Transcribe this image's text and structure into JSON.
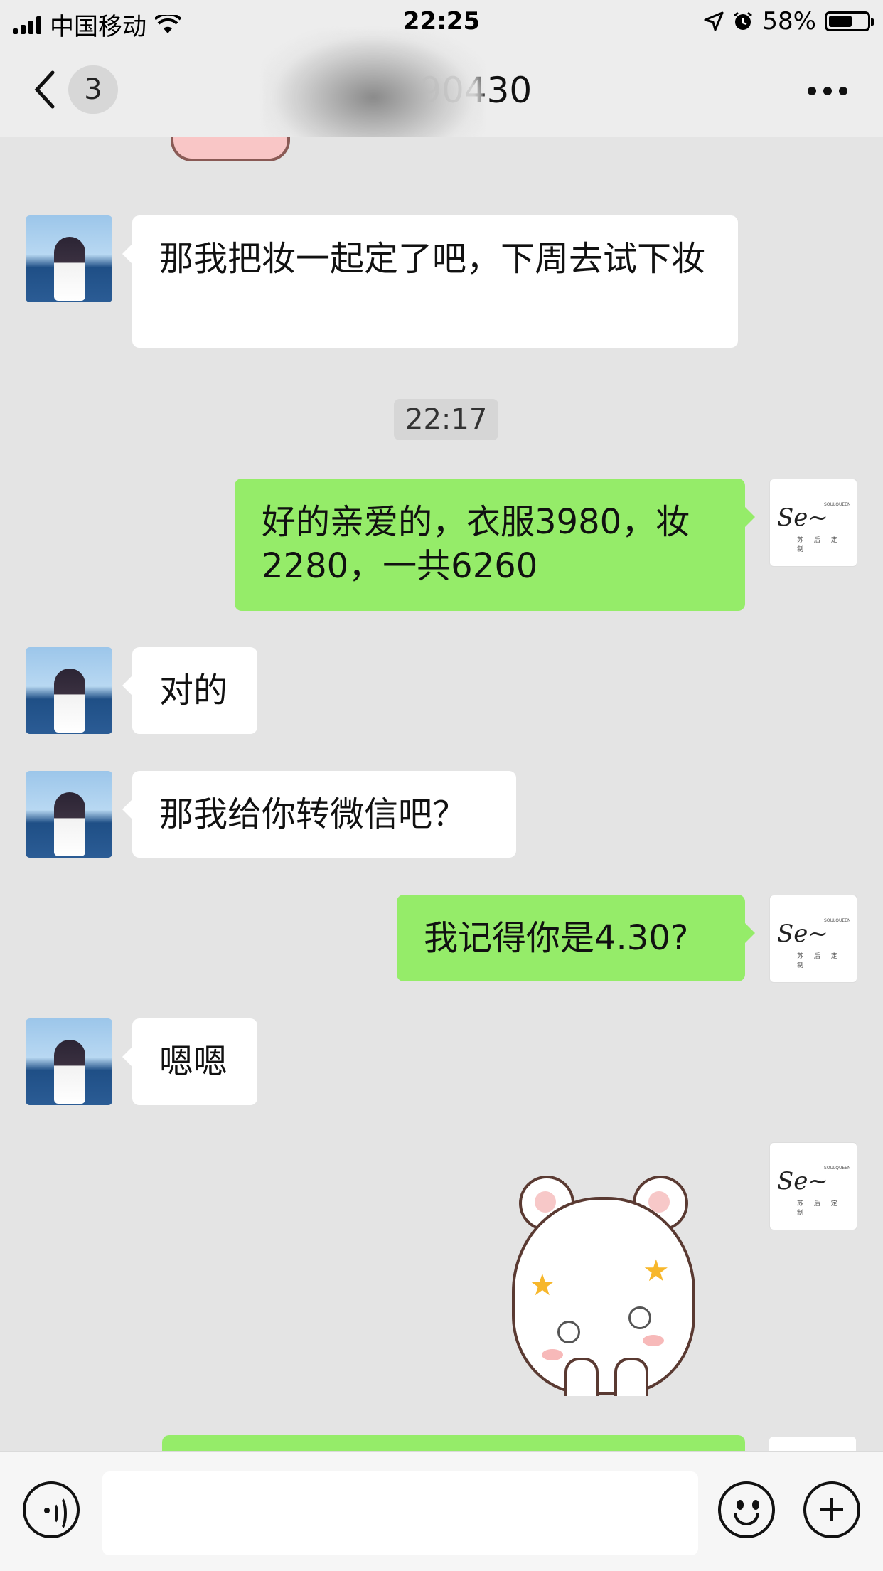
{
  "status_bar": {
    "carrier": "中国移动",
    "time": "22:25",
    "battery": "58%",
    "icons": [
      "signal-icon",
      "wifi-icon",
      "location-icon",
      "alarm-icon",
      "battery-icon"
    ]
  },
  "nav": {
    "unread_count": "3",
    "title": "20190430",
    "icons": [
      "back-chevron-icon",
      "more-icon"
    ]
  },
  "messages": [
    {
      "from": "them",
      "text": "那我把妆一起定了吧，下周去试下妆"
    },
    {
      "type": "time",
      "text": "22:17"
    },
    {
      "from": "me",
      "text": "好的亲爱的，衣服3980，妆2280，一共6260"
    },
    {
      "from": "them",
      "text": "对的"
    },
    {
      "from": "them",
      "text": "那我给你转微信吧？"
    },
    {
      "from": "me",
      "text": "我记得你是4.30?"
    },
    {
      "from": "them",
      "text": "嗯嗯"
    },
    {
      "from": "me",
      "type": "sticker",
      "sticker": "dizzy-bear-sticker"
    }
  ],
  "input_bar": {
    "placeholder": "",
    "icons": [
      "voice-icon",
      "emoji-icon",
      "plus-icon"
    ]
  },
  "colors": {
    "outgoing_bubble": "#95ec69",
    "incoming_bubble": "#ffffff",
    "chat_background": "#e4e4e4"
  }
}
